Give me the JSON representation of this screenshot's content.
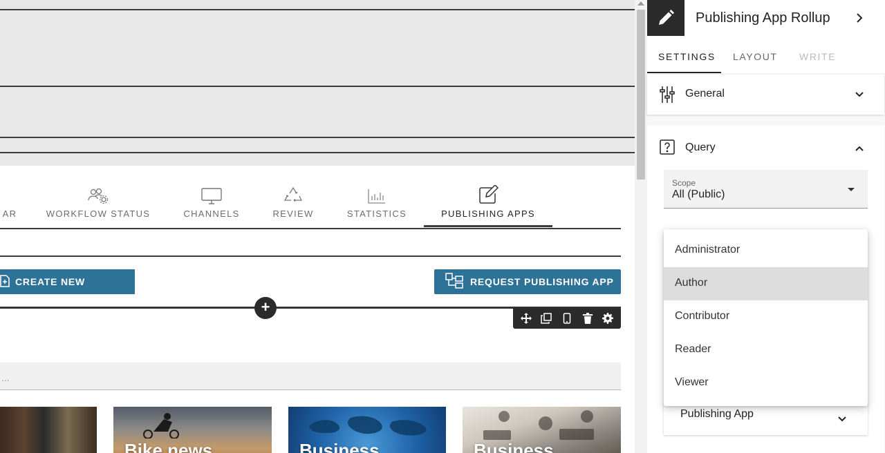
{
  "canvas": {
    "tabs": [
      {
        "label": "AR",
        "icon": "calendar-icon"
      },
      {
        "label": "WORKFLOW STATUS",
        "icon": "users-gear-icon"
      },
      {
        "label": "CHANNELS",
        "icon": "monitor-icon"
      },
      {
        "label": "REVIEW",
        "icon": "recycle-icon"
      },
      {
        "label": "STATISTICS",
        "icon": "bar-chart-icon"
      },
      {
        "label": "PUBLISHING APPS",
        "icon": "edit-icon",
        "active": true
      }
    ],
    "create_button": "CREATE NEW",
    "request_button": "REQUEST PUBLISHING APP",
    "search_placeholder": "...",
    "cards": [
      {
        "label": ""
      },
      {
        "label": "Bike news"
      },
      {
        "label": "Business"
      },
      {
        "label": "Business"
      }
    ]
  },
  "panel": {
    "title": "Publishing App Rollup",
    "tabs": [
      {
        "label": "SETTINGS",
        "state": "active"
      },
      {
        "label": "LAYOUT",
        "state": "normal"
      },
      {
        "label": "WRITE",
        "state": "disabled"
      }
    ],
    "general_label": "General",
    "query_label": "Query",
    "scope_label": "Scope",
    "scope_value": "All (Public)",
    "publishing_app_label": "Publishing App"
  },
  "dropdown": {
    "options": [
      "Administrator",
      "Author",
      "Contributor",
      "Reader",
      "Viewer"
    ],
    "hovered_index": 1
  },
  "colors": {
    "accent_button": "#2e7397",
    "dark": "#2b2b2b",
    "canvas_band": "#e8e8e8"
  }
}
